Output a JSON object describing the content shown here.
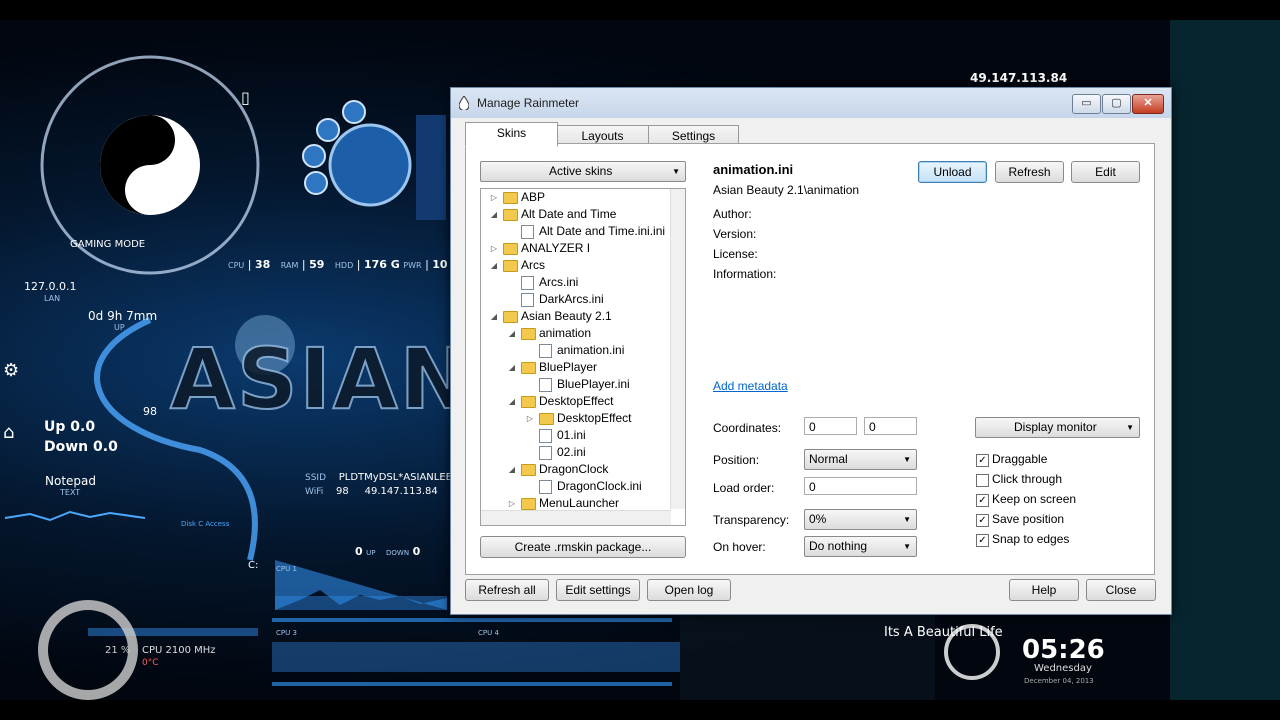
{
  "desktop": {
    "ip_top": "49.147.113.84",
    "gaming_mode": "GAMING MODE",
    "localhost": "127.0.0.1",
    "lan": "LAN",
    "uptime": "0d 9h 7mm",
    "up_label": "UP",
    "stats": {
      "cpu_label": "CPU",
      "cpu": "38",
      "ram_label": "RAM",
      "ram": "59",
      "hdd_label": "HDD",
      "hdd": "176 G",
      "pwr_label": "PWR",
      "pwr": "10"
    },
    "net_up": "Up 0.0",
    "net_down": "Down 0.0",
    "wifi_signal": "98",
    "notepad": "Notepad",
    "notepad_sub": "TEXT",
    "ssid_label": "SSID",
    "ssid": "PLDTMyDSL*ASIANLEE*",
    "wifi_label": "WiFi",
    "wifi_val": "98",
    "wifi_ip": "49.147.113.84",
    "disk_access": "Disk C Access",
    "drive_c": "C:",
    "up_val": "0",
    "up_small": "UP",
    "down_small": "DOWN",
    "down_val": "0",
    "cpu1": "CPU 1",
    "cpu3": "CPU 3",
    "cpu4": "CPU 4",
    "cpu_pct": "21 %",
    "cpu_mhz": "CPU 2100 MHz",
    "cpu_temp": "0°C",
    "quote": "Its A Beautiful Life",
    "clock": "05:26",
    "weekday": "Wednesday",
    "date": "December 04, 2013",
    "brand": "ASIAN"
  },
  "window": {
    "title": "Manage Rainmeter",
    "min": "▭",
    "max": "▢",
    "close": "✕",
    "tabs": [
      {
        "label": "Skins"
      },
      {
        "label": "Layouts"
      },
      {
        "label": "Settings"
      }
    ],
    "active_skins": "Active skins",
    "tree": [
      {
        "label": "ABP",
        "type": "folder",
        "depth": 0,
        "exp": "▷"
      },
      {
        "label": "Alt Date and Time",
        "type": "folder",
        "depth": 0,
        "exp": "◢"
      },
      {
        "label": "Alt Date and Time.ini.ini",
        "type": "file",
        "depth": 1,
        "exp": ""
      },
      {
        "label": "ANALYZER I",
        "type": "folder",
        "depth": 0,
        "exp": "▷"
      },
      {
        "label": "Arcs",
        "type": "folder",
        "depth": 0,
        "exp": "◢"
      },
      {
        "label": "Arcs.ini",
        "type": "file",
        "depth": 1,
        "exp": ""
      },
      {
        "label": "DarkArcs.ini",
        "type": "file",
        "depth": 1,
        "exp": ""
      },
      {
        "label": "Asian Beauty 2.1",
        "type": "folder",
        "depth": 0,
        "exp": "◢"
      },
      {
        "label": "animation",
        "type": "folder",
        "depth": 1,
        "exp": "◢"
      },
      {
        "label": "animation.ini",
        "type": "file",
        "depth": 2,
        "exp": ""
      },
      {
        "label": "BluePlayer",
        "type": "folder",
        "depth": 1,
        "exp": "◢"
      },
      {
        "label": "BluePlayer.ini",
        "type": "file",
        "depth": 2,
        "exp": ""
      },
      {
        "label": "DesktopEffect",
        "type": "folder",
        "depth": 1,
        "exp": "◢"
      },
      {
        "label": "DesktopEffect",
        "type": "folder",
        "depth": 2,
        "exp": "▷"
      },
      {
        "label": "01.ini",
        "type": "file",
        "depth": 2,
        "exp": ""
      },
      {
        "label": "02.ini",
        "type": "file",
        "depth": 2,
        "exp": ""
      },
      {
        "label": "DragonClock",
        "type": "folder",
        "depth": 1,
        "exp": "◢"
      },
      {
        "label": "DragonClock.ini",
        "type": "file",
        "depth": 2,
        "exp": ""
      },
      {
        "label": "MenuLauncher",
        "type": "folder",
        "depth": 1,
        "exp": "▷"
      }
    ],
    "create_package": "Create .rmskin package...",
    "skin_name": "animation.ini",
    "skin_path": "Asian Beauty 2.1\\animation",
    "unload": "Unload",
    "refresh": "Refresh",
    "edit": "Edit",
    "author": "Author:",
    "version": "Version:",
    "license": "License:",
    "information": "Information:",
    "add_metadata": "Add metadata",
    "coordinates_label": "Coordinates:",
    "coord_x": "0",
    "coord_y": "0",
    "display_monitor": "Display monitor",
    "position_label": "Position:",
    "position_value": "Normal",
    "load_order_label": "Load order:",
    "load_order_value": "0",
    "transparency_label": "Transparency:",
    "transparency_value": "0%",
    "on_hover_label": "On hover:",
    "on_hover_value": "Do nothing",
    "checks": [
      {
        "label": "Draggable",
        "checked": true
      },
      {
        "label": "Click through",
        "checked": false
      },
      {
        "label": "Keep on screen",
        "checked": true
      },
      {
        "label": "Save position",
        "checked": true
      },
      {
        "label": "Snap to edges",
        "checked": true
      }
    ],
    "refresh_all": "Refresh all",
    "edit_settings": "Edit settings",
    "open_log": "Open log",
    "help": "Help",
    "close_btn": "Close"
  }
}
